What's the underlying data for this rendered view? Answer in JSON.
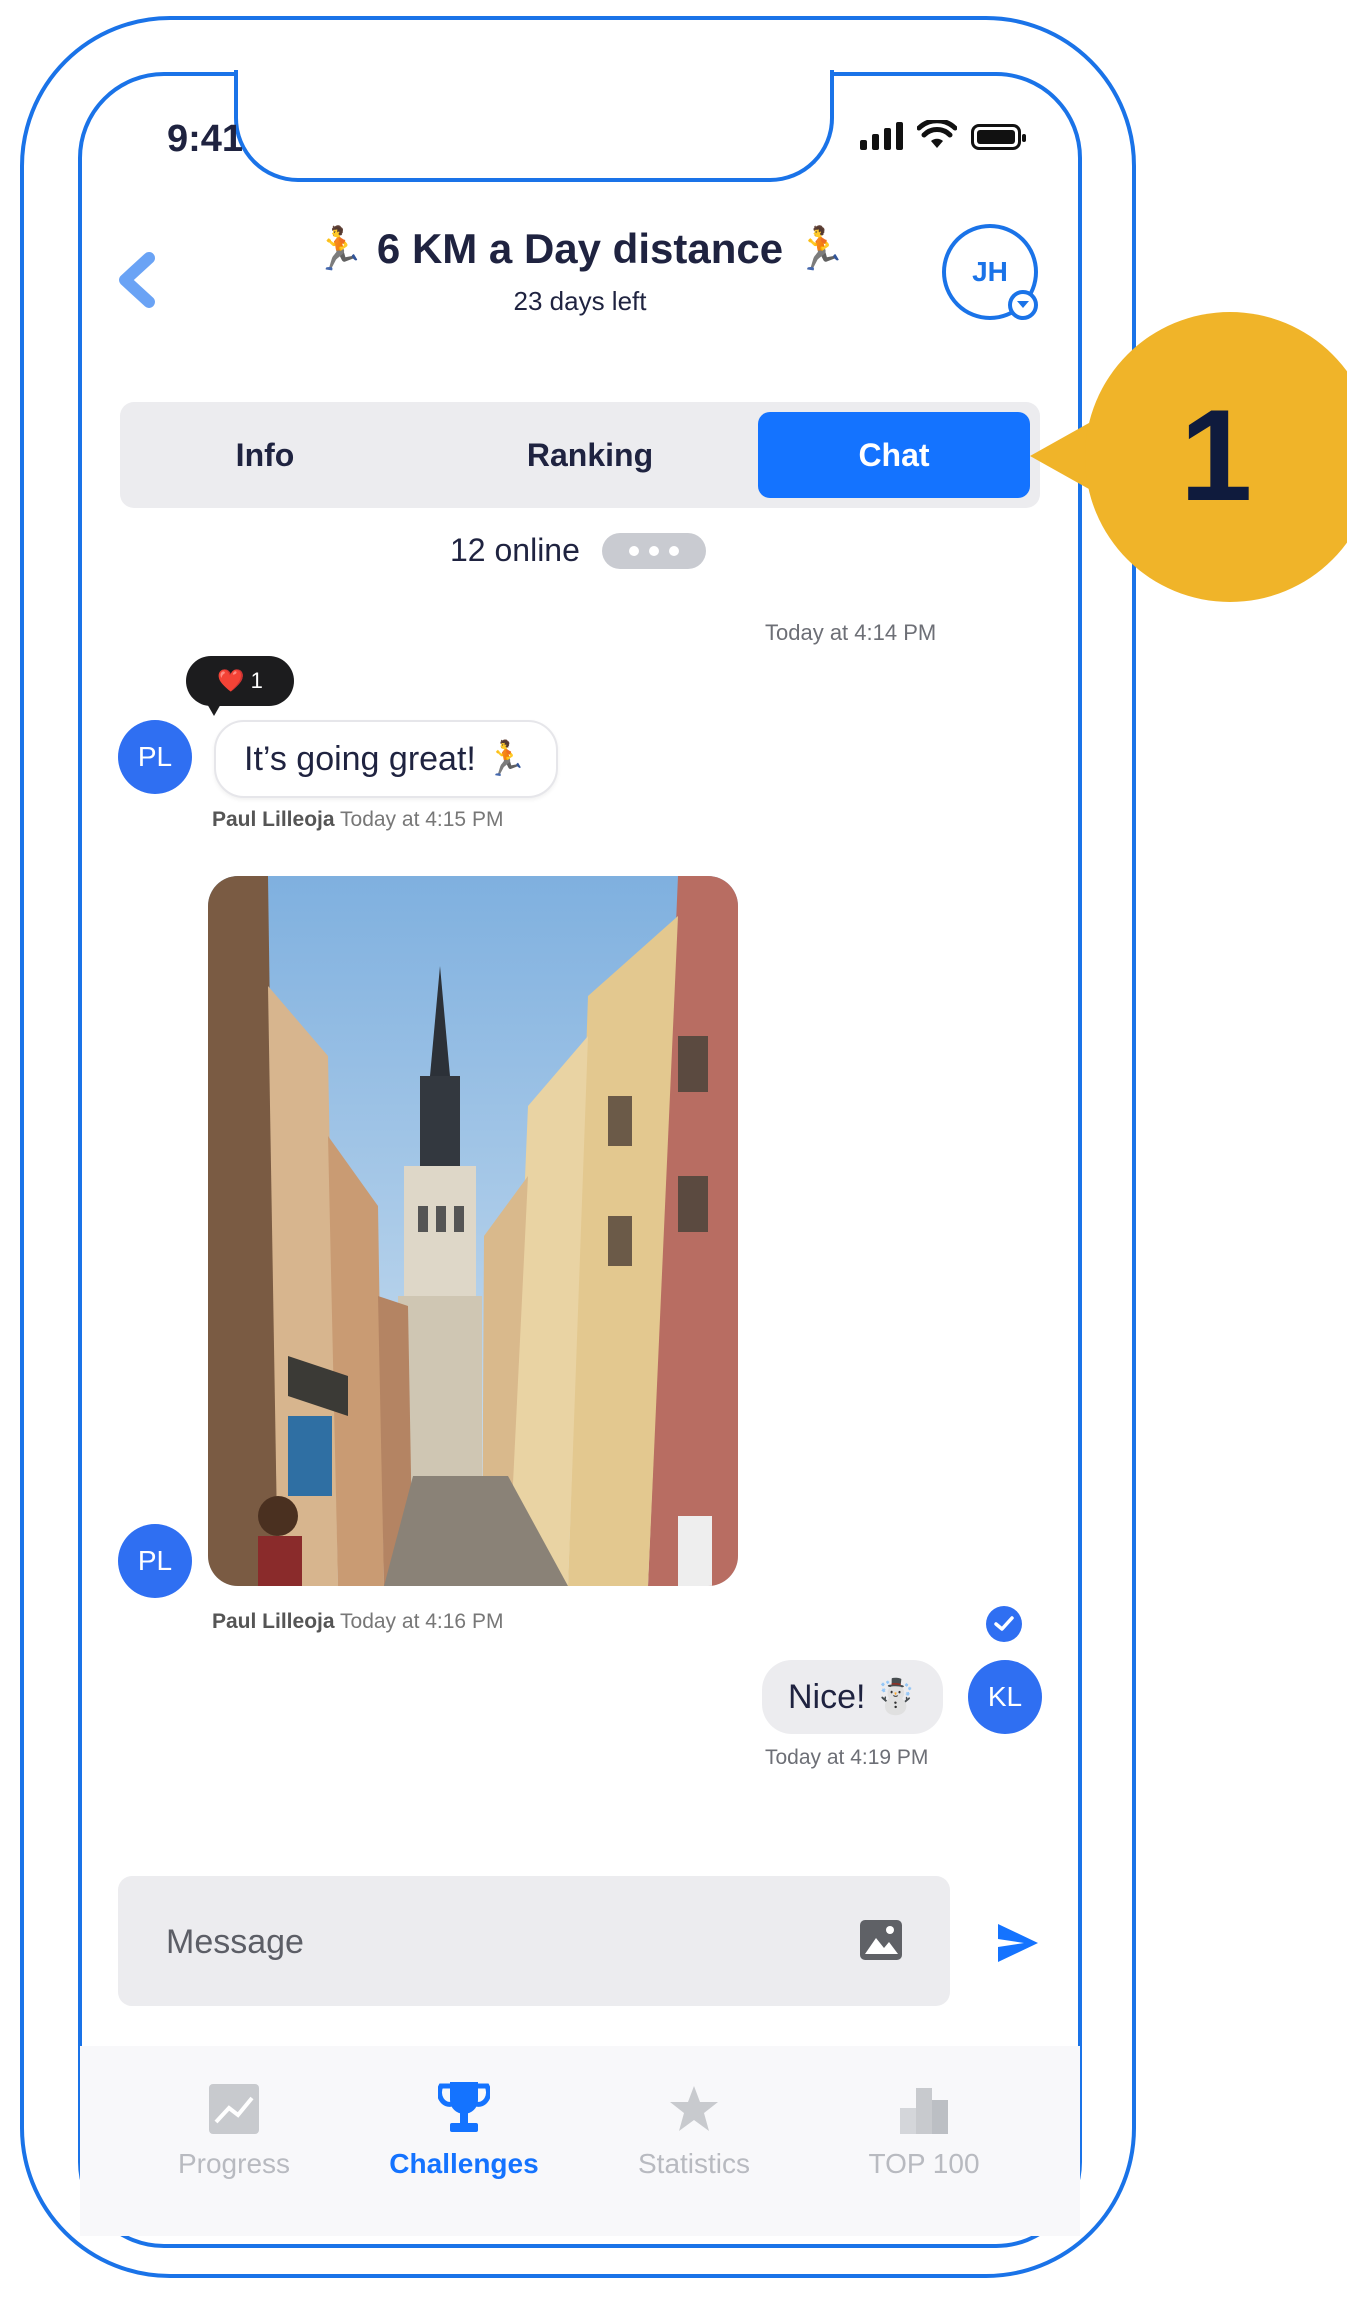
{
  "status": {
    "time": "9:41"
  },
  "header": {
    "title": "🏃 6 KM a Day distance 🏃",
    "subtitle": "23 days left",
    "user_initials": "JH"
  },
  "tabs": [
    {
      "label": "Info",
      "active": false
    },
    {
      "label": "Ranking",
      "active": false
    },
    {
      "label": "Chat",
      "active": true
    }
  ],
  "online_text": "12 online",
  "callout_number": "1",
  "chat": {
    "top_timestamp": "Today at 4:14 PM",
    "reaction": {
      "emoji": "❤️",
      "count": "1"
    },
    "messages": [
      {
        "initials": "PL",
        "text": "It’s going great! 🏃",
        "author": "Paul Lilleoja",
        "time": "Today at 4:15 PM"
      },
      {
        "initials": "PL",
        "text": "",
        "author": "Paul Lilleoja",
        "time": "Today at 4:16 PM"
      },
      {
        "initials": "KL",
        "text": "Nice! ☃️",
        "author": "",
        "time": "Today at 4:19 PM"
      }
    ]
  },
  "composer": {
    "placeholder": "Message"
  },
  "nav": [
    {
      "label": "Progress",
      "icon": "chart-icon",
      "active": false
    },
    {
      "label": "Challenges",
      "icon": "trophy-icon",
      "active": true
    },
    {
      "label": "Statistics",
      "icon": "star-icon",
      "active": false
    },
    {
      "label": "TOP 100",
      "icon": "podium-icon",
      "active": false
    }
  ],
  "colors": {
    "accent": "#1473ff",
    "callout": "#f0b429",
    "frame": "#1a73e8",
    "avatar": "#2f6ff2"
  }
}
